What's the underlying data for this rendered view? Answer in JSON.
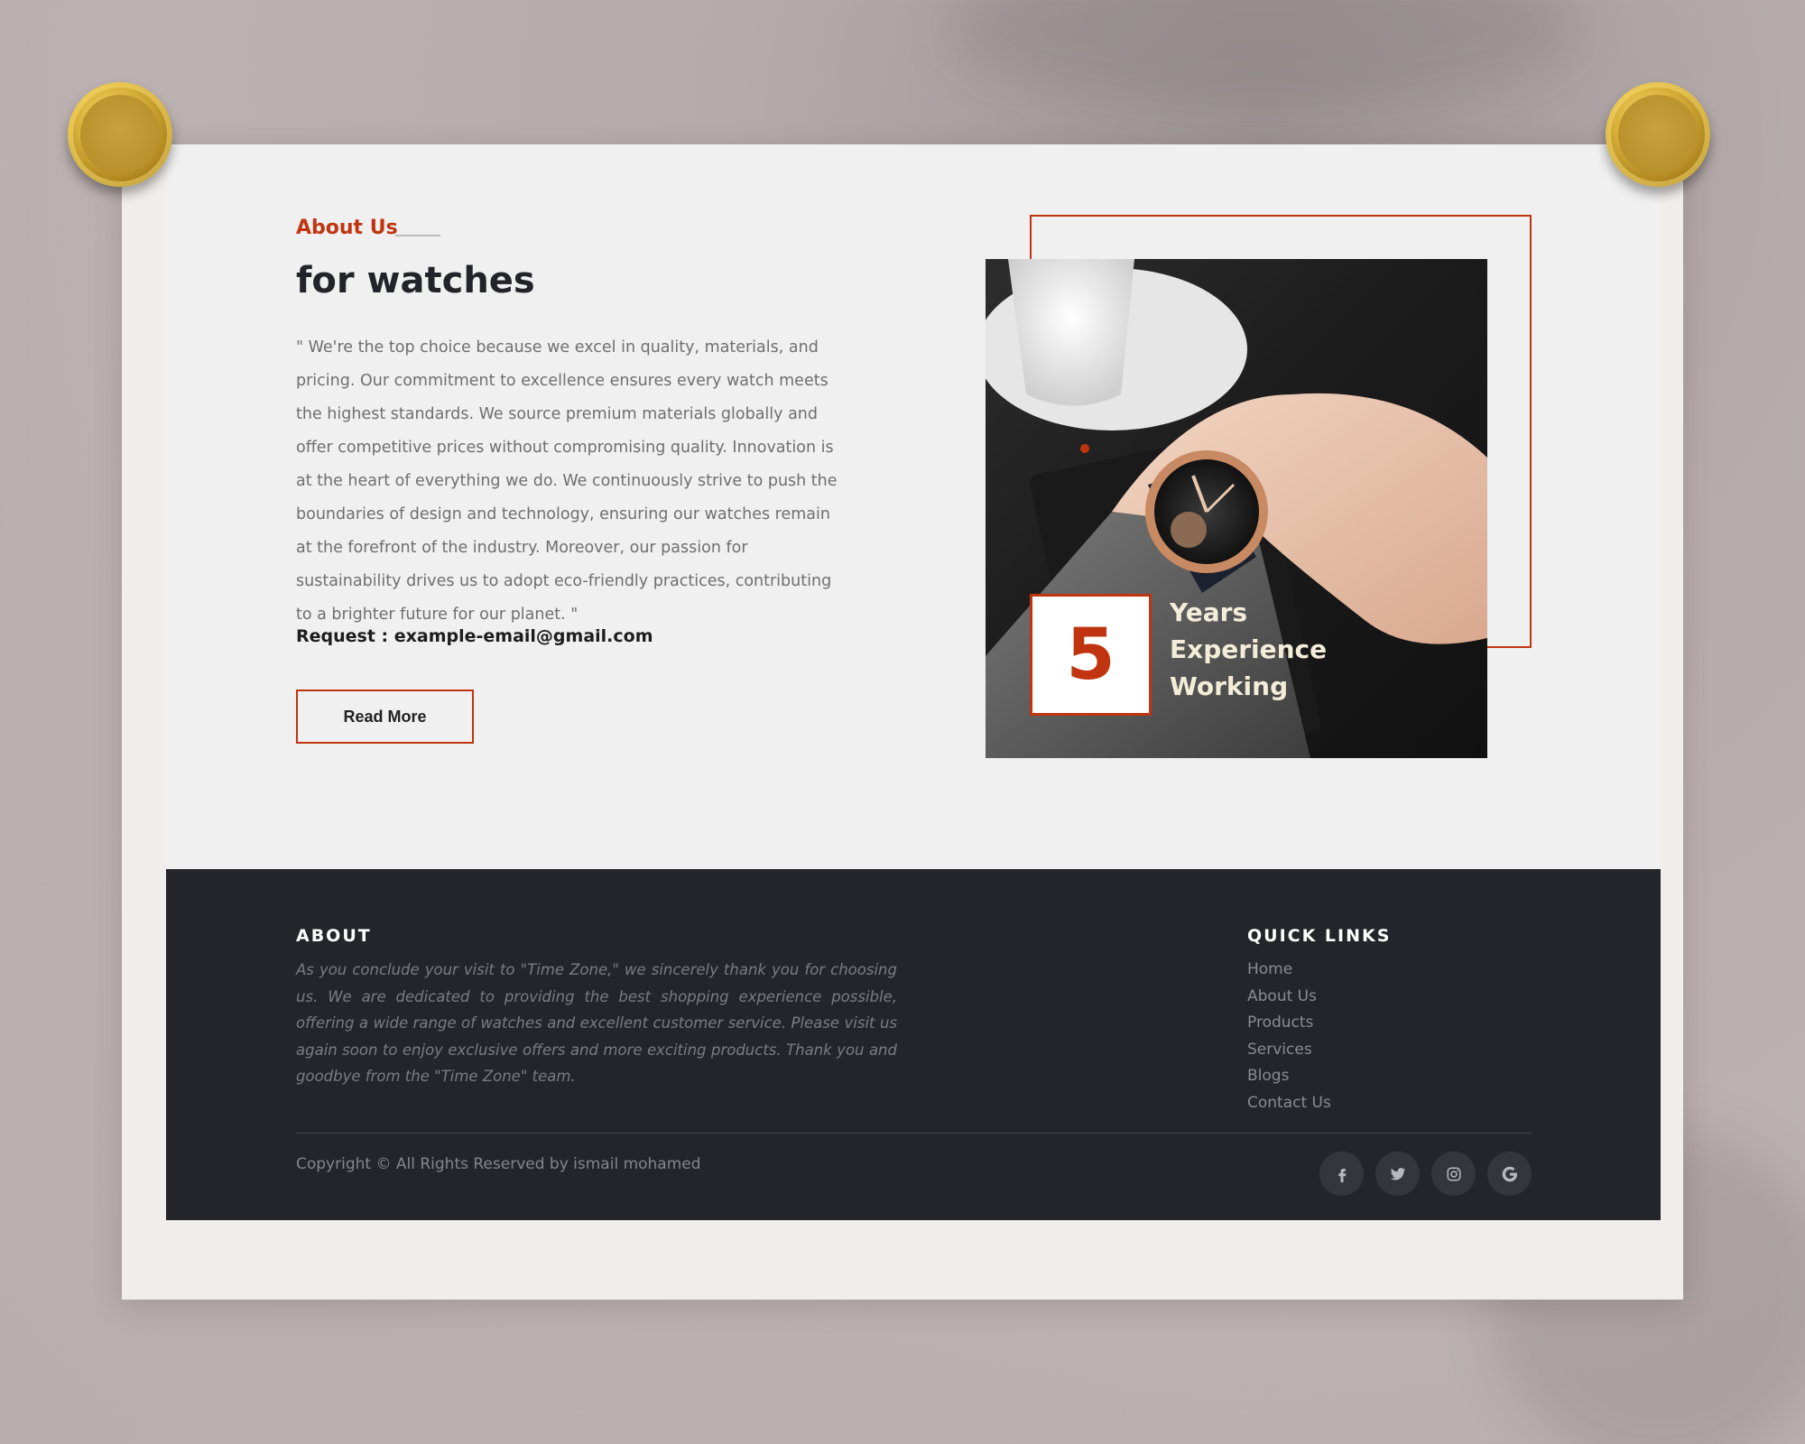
{
  "about": {
    "label": "About Us",
    "title": "for watches",
    "description": "\" We're the top choice because we excel in quality, materials, and pricing. Our commitment to excellence ensures every watch meets the highest standards. We source premium materials globally and offer competitive prices without compromising quality. Innovation is at the heart of everything we do. We continuously strive to push the boundaries of design and technology, ensuring our watches remain at the forefront of the industry. Moreover, our passion for sustainability drives us to adopt eco-friendly practices, contributing to a brighter future for our planet. \"",
    "request": "Request : example-email@gmail.com",
    "read_more_label": "Read More"
  },
  "experience": {
    "number": "5",
    "line1": "Years",
    "line2": "Experience",
    "line3": "Working"
  },
  "footer": {
    "about_heading": "ABOUT",
    "about_text": "As you conclude your visit to \"Time Zone,\" we sincerely thank you for choosing us. We are dedicated to providing the best shopping experience possible, offering a wide range of watches and excellent customer service. Please visit us again soon to enjoy exclusive offers and more exciting products. Thank you and goodbye from the \"Time Zone\" team.",
    "links_heading": "QUICK LINKS",
    "links": [
      "Home",
      "About Us",
      "Products",
      "Services",
      "Blogs",
      "Contact Us"
    ],
    "copyright": "Copyright © All Rights Reserved by ismail mohamed",
    "social": [
      "facebook-icon",
      "twitter-icon",
      "instagram-icon",
      "google-icon"
    ]
  },
  "colors": {
    "accent": "#c0350f",
    "footer_bg": "#24252a",
    "page_bg": "#f0f0f0"
  }
}
